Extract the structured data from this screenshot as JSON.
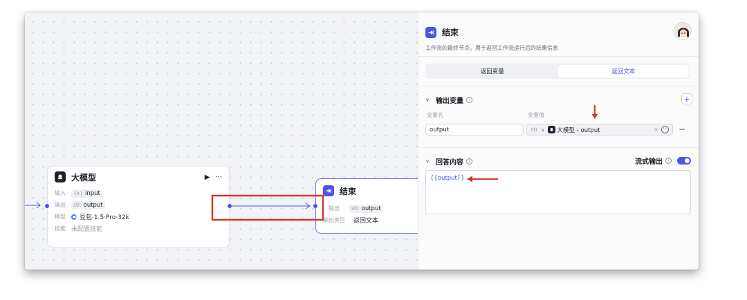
{
  "canvas": {
    "llm_node": {
      "title": "大模型",
      "input_label": "输入",
      "input_type": "{x}",
      "input_value": "input",
      "output_label": "输出",
      "output_type": "str.",
      "output_value": "output",
      "model_label": "模型",
      "model_value": "豆包·1.5·Pro·32k",
      "skill_label": "技能",
      "skill_value": "未配置技能",
      "run_icon": "play-icon",
      "more_icon": "more-icon"
    },
    "end_node": {
      "title": "结束",
      "output_label": "输出",
      "output_type": "str.",
      "output_value": "output",
      "output_type_label": "输出类型",
      "output_type_value": "返回文本"
    }
  },
  "panel": {
    "title": "结束",
    "description": "工作流的最终节点，用于返回工作流运行后的结果信息",
    "tabs": [
      {
        "label": "返回变量",
        "active": false
      },
      {
        "label": "返回文本",
        "active": true
      }
    ],
    "output_vars": {
      "heading": "输出变量",
      "add_label": "+",
      "name_header": "变量名",
      "value_header": "变量值",
      "name_value": "output",
      "value_type": "str.",
      "value_ref": "大模型 - output",
      "clear_label": "×",
      "remove_label": "−"
    },
    "answer": {
      "heading": "回答内容",
      "stream_label": "流式输出",
      "stream_enabled": true,
      "content": "{{output}}"
    }
  },
  "colors": {
    "accent": "#4d53e8",
    "annotation": "#d0392b"
  }
}
